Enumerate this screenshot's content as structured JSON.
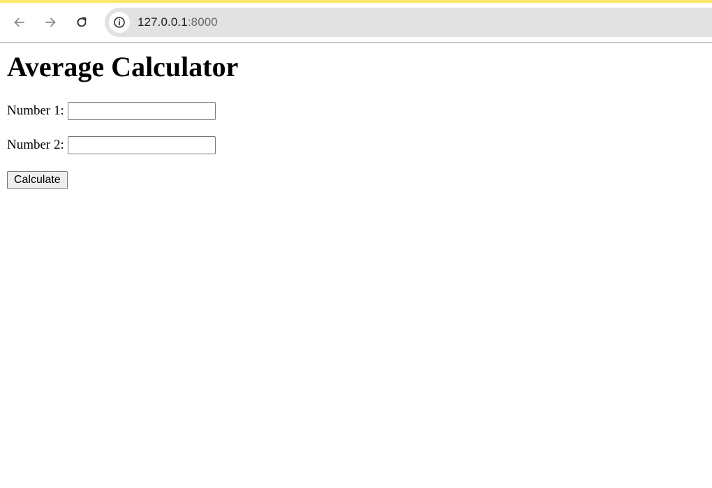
{
  "browser": {
    "url_host": "127.0.0.1",
    "url_port": ":8000",
    "icons": {
      "back": "arrow-left-icon",
      "forward": "arrow-right-icon",
      "reload": "reload-icon",
      "site_info": "info-icon"
    },
    "accent_color": "#fde86b"
  },
  "page": {
    "title": "Average Calculator",
    "fields": [
      {
        "label": "Number 1:",
        "value": ""
      },
      {
        "label": "Number 2:",
        "value": ""
      }
    ],
    "calculate_label": "Calculate"
  }
}
